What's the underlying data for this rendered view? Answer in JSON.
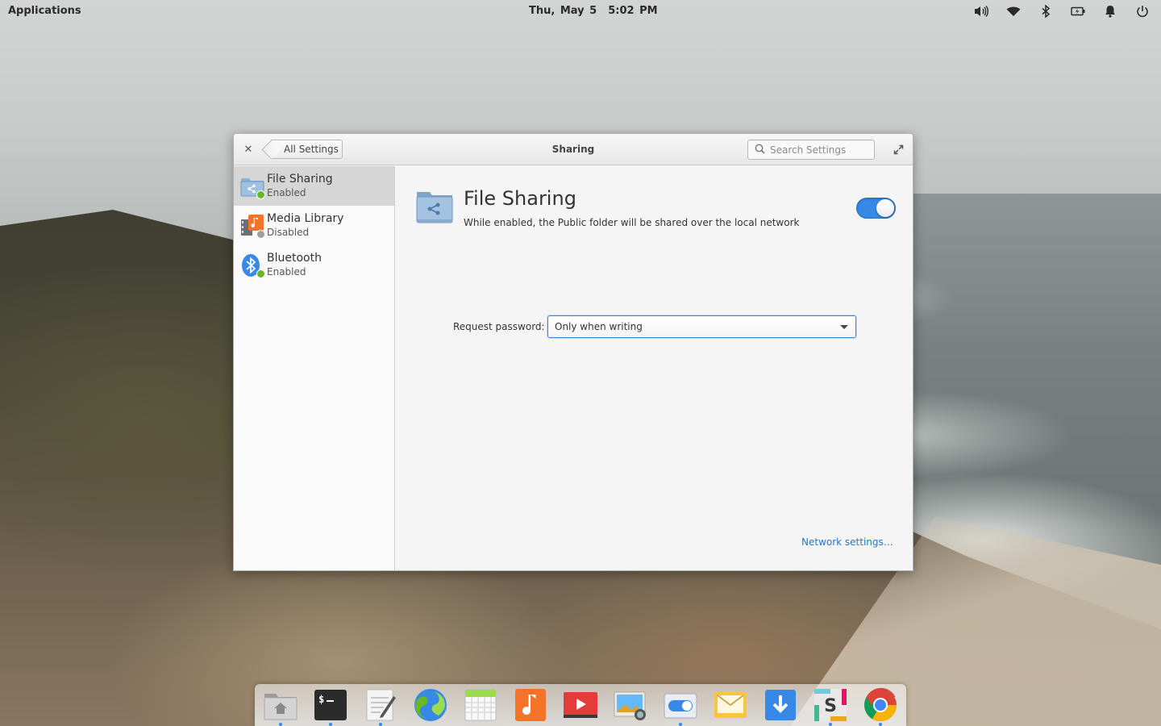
{
  "panel": {
    "applications_label": "Applications",
    "date": "Thu, May 5",
    "time": "5:02 PM",
    "indicators": [
      "volume-icon",
      "wifi-icon",
      "bluetooth-icon",
      "battery-icon",
      "notifications-icon",
      "power-icon"
    ]
  },
  "window": {
    "title": "Sharing",
    "back_label": "All Settings",
    "search_placeholder": "Search Settings",
    "accent_color": "#3689e6"
  },
  "sidebar": {
    "items": [
      {
        "name": "File Sharing",
        "status": "Enabled",
        "icon": "folder-share-icon",
        "status_color": "#68b723",
        "active": true
      },
      {
        "name": "Media Library",
        "status": "Disabled",
        "icon": "media-library-icon",
        "status_color": "#a0a0a0",
        "active": false
      },
      {
        "name": "Bluetooth",
        "status": "Enabled",
        "icon": "bluetooth-icon",
        "status_color": "#68b723",
        "active": false
      }
    ]
  },
  "content": {
    "title": "File Sharing",
    "description": "While enabled, the Public folder will be shared over the local network",
    "toggle_on": true,
    "password_label": "Request password:",
    "password_value": "Only when writing",
    "network_link": "Network settings…"
  },
  "dock": {
    "items": [
      {
        "icon": "files-icon",
        "running": true
      },
      {
        "icon": "terminal-icon",
        "running": true
      },
      {
        "icon": "text-editor-icon",
        "running": true
      },
      {
        "icon": "web-browser-icon",
        "running": false
      },
      {
        "icon": "calendar-icon",
        "running": false
      },
      {
        "icon": "music-icon",
        "running": false
      },
      {
        "icon": "videos-icon",
        "running": false
      },
      {
        "icon": "photos-icon",
        "running": false
      },
      {
        "icon": "system-settings-icon",
        "running": true
      },
      {
        "icon": "mail-icon",
        "running": false
      },
      {
        "icon": "downloads-icon",
        "running": false
      },
      {
        "icon": "slack-icon",
        "running": true
      },
      {
        "icon": "chrome-icon",
        "running": true
      }
    ]
  }
}
